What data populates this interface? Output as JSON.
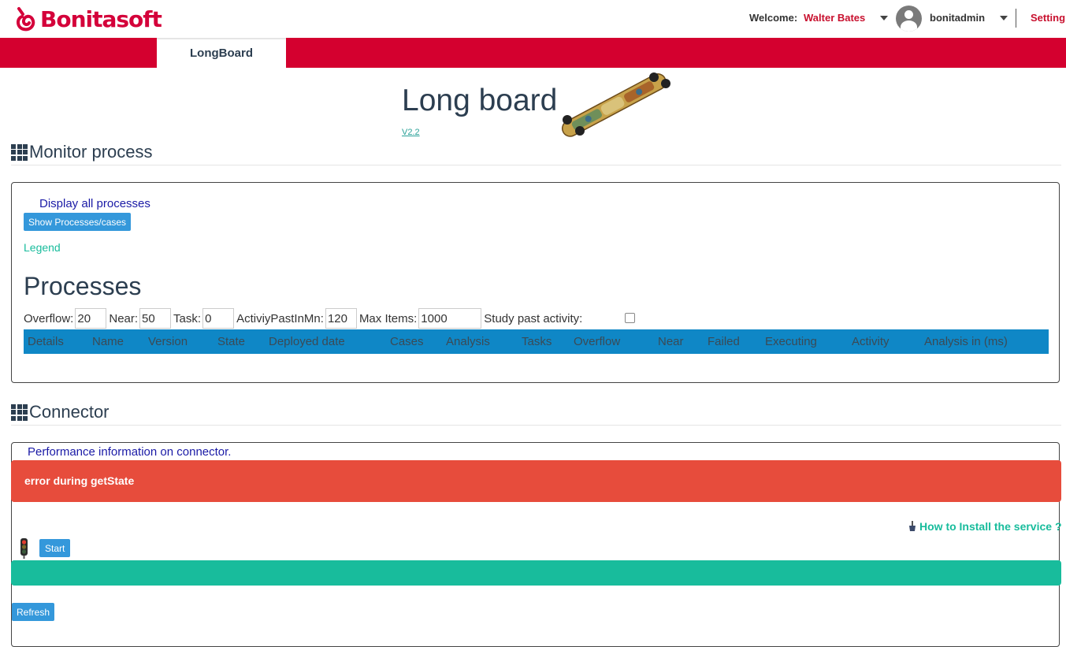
{
  "header": {
    "brand": "Bonitasoft",
    "welcome_label": "Welcome:",
    "user_name": "Walter Bates",
    "login": "bonitadmin",
    "settings": "Setting"
  },
  "nav": {
    "active_tab": "LongBoard"
  },
  "app": {
    "title": "Long board",
    "version": "V2.2"
  },
  "monitor": {
    "section_title": "Monitor process",
    "display_all": "Display all processes",
    "show_button": "Show Processes/cases",
    "legend": "Legend",
    "processes_title": "Processes",
    "filters": {
      "overflow_label": "Overflow:",
      "overflow_value": "20",
      "near_label": "Near:",
      "near_value": "50",
      "task_label": "Task:",
      "task_value": "0",
      "activity_label": "ActiviyPastInMn:",
      "activity_value": "120",
      "maxitems_label": "Max Items:",
      "maxitems_value": "1000",
      "study_label": "Study past activity:"
    },
    "columns": [
      "Details",
      "Name",
      "Version",
      "State",
      "Deployed date",
      "Cases",
      "Analysis",
      "Tasks",
      "Overflow",
      "Near",
      "Failed",
      "Executing",
      "Activity",
      "Analysis in (ms)"
    ]
  },
  "connector": {
    "section_title": "Connector",
    "performance_label": "Performance information on connector.",
    "error_text": "error during getState",
    "howto_link": "How to Install the service ?",
    "start_button": "Start",
    "refresh_button": "Refresh"
  },
  "colors": {
    "brand_red": "#d4002f",
    "primary_blue": "#3498db",
    "table_header": "#0f87c6",
    "error": "#e74c3c",
    "success": "#18bc9c",
    "heading": "#2c3e50"
  },
  "icons": [
    "bonitasoft-logo-icon",
    "caret-down-icon",
    "user-avatar-icon",
    "grid-icon",
    "traffic-light-icon",
    "wrench-icon"
  ]
}
